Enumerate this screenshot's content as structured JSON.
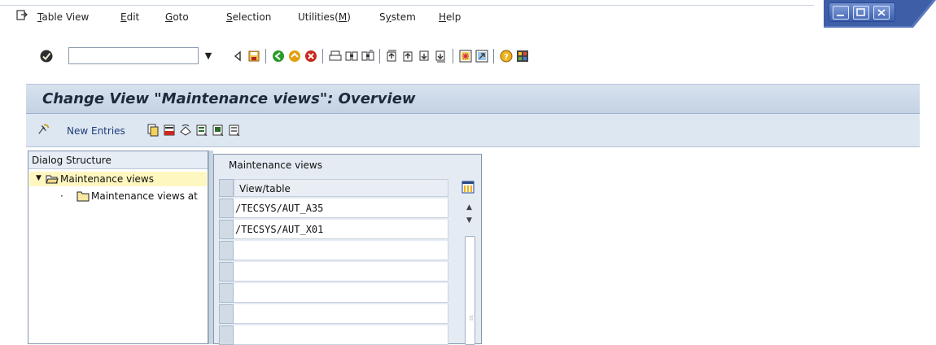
{
  "menu": {
    "items": [
      {
        "label": "Table View",
        "ul": "T",
        "rest": "able View"
      },
      {
        "label": "Edit",
        "ul": "E",
        "rest": "dit"
      },
      {
        "label": "Goto",
        "ul": "G",
        "rest": "oto"
      },
      {
        "label": "Selection",
        "ul": "S",
        "rest": "election"
      },
      {
        "label": "Utilities(M)",
        "pre": "Utilities(",
        "ul": "M",
        "post": ")"
      },
      {
        "label": "System",
        "pre": "S",
        "ul": "y",
        "post": "stem"
      },
      {
        "label": "Help",
        "ul": "H",
        "rest": "elp"
      }
    ]
  },
  "toolbar": {
    "command_value": "",
    "icons": [
      "enter-icon",
      "dropdown-icon",
      "back-triangle-icon",
      "save-icon",
      "back-icon",
      "exit-icon",
      "cancel-icon",
      "print-icon",
      "find-icon",
      "find-next-icon",
      "first-page-icon",
      "previous-page-icon",
      "next-page-icon",
      "last-page-icon",
      "create-session-icon",
      "shortcut-icon",
      "help-icon",
      "customize-layout-icon"
    ]
  },
  "screen": {
    "title": "Change View \"Maintenance views\": Overview"
  },
  "app_toolbar": {
    "new_entries": "New Entries"
  },
  "dialog_structure": {
    "title": "Dialog Structure",
    "items": [
      {
        "label": "Maintenance views",
        "selected": true,
        "expanded": true
      },
      {
        "label": "Maintenance views at"
      }
    ]
  },
  "table": {
    "title": "Maintenance views",
    "column_header": "View/table",
    "rows": [
      "/TECSYS/AUT_A35",
      "/TECSYS/AUT_X01",
      "",
      "",
      "",
      "",
      "",
      ""
    ]
  },
  "colors": {
    "title_band": "#c3d2e3",
    "selected_tree": "#fff7c0",
    "window_controls": "#3c5fae"
  }
}
